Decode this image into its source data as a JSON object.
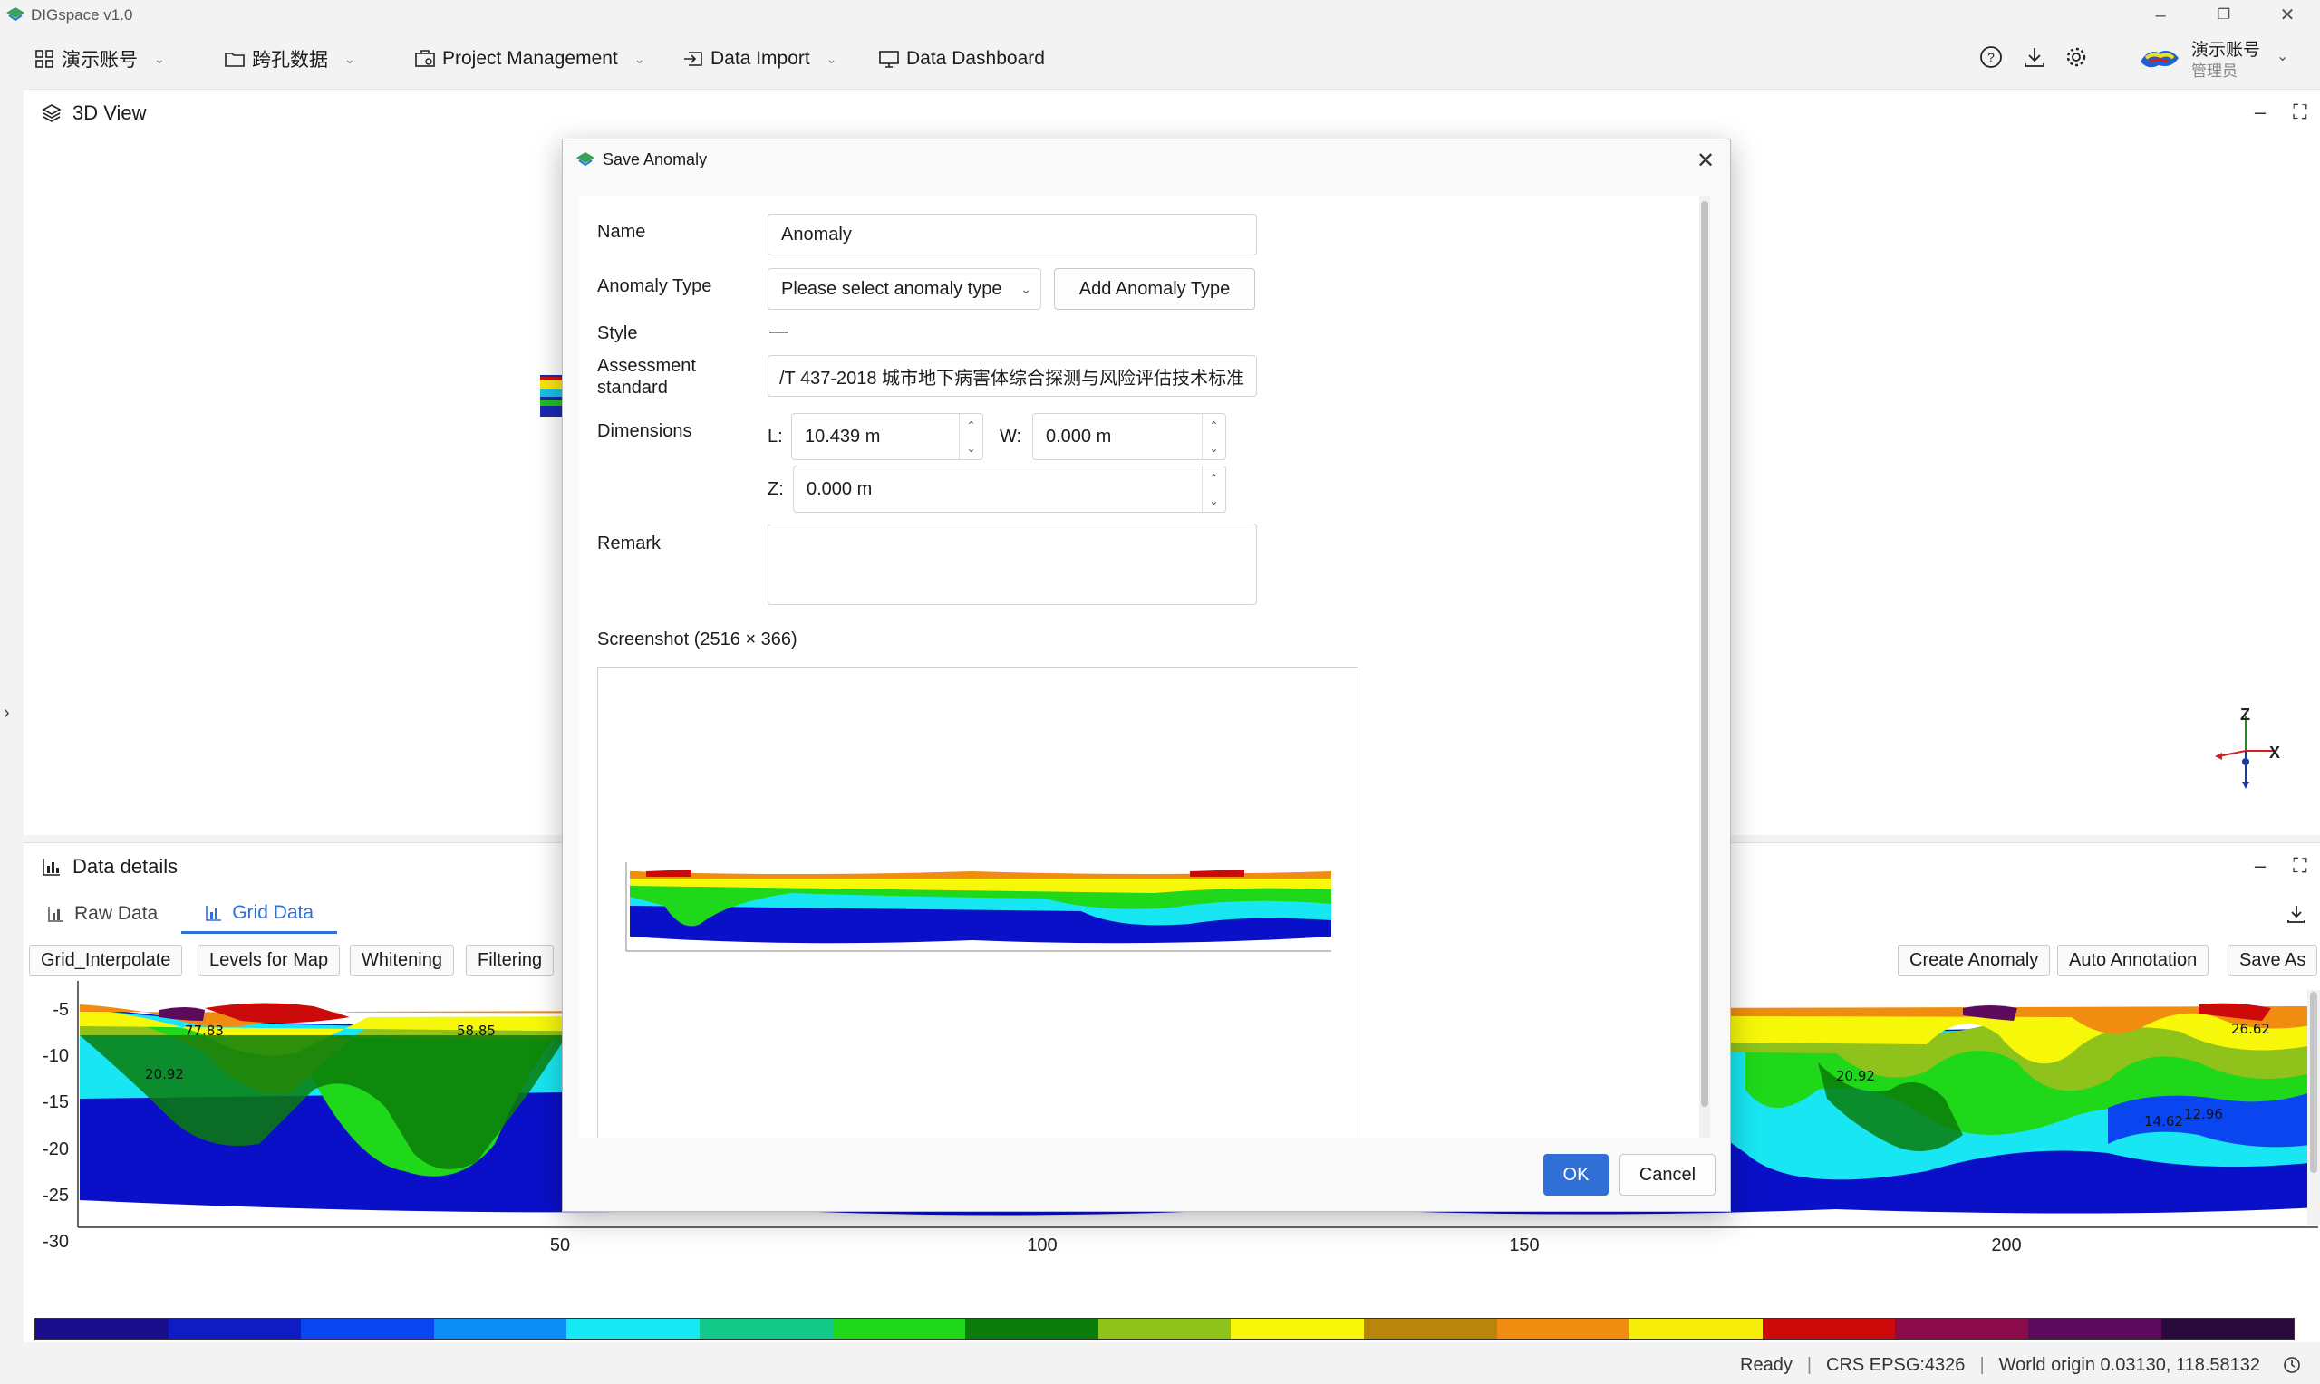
{
  "app": {
    "title": "DIGspace v1.0"
  },
  "menu": {
    "account": "演示账号",
    "borehole": "跨孔数据",
    "project": "Project Management",
    "import": "Data Import",
    "dashboard": "Data Dashboard"
  },
  "user": {
    "name": "演示账号",
    "role": "管理员"
  },
  "view3d": {
    "title": "3D View"
  },
  "details": {
    "title": "Data details",
    "tabs": [
      "Raw Data",
      "Grid Data"
    ],
    "active_tab": "Grid Data",
    "left_buttons": [
      "Grid_Interpolate",
      "Levels for Map",
      "Whitening",
      "Filtering"
    ],
    "right_buttons": [
      "Create Anomaly",
      "Auto Annotation",
      "Save As"
    ],
    "y_ticks": [
      "-5",
      "-10",
      "-15",
      "-20",
      "-25",
      "-30"
    ],
    "x_ticks": [
      "50",
      "100",
      "150",
      "200"
    ],
    "contour_labels": [
      "77.83",
      "58.85",
      "20.92",
      "14.62",
      "12.96",
      "26.62",
      "20.92"
    ]
  },
  "colorbar": [
    "#1a0d8c",
    "#0f1cc4",
    "#0a46f0",
    "#0c8cf5",
    "#17e8f6",
    "#13c98a",
    "#1fd81a",
    "#0a7d0a",
    "#8fc21a",
    "#f7f70a",
    "#b8860b",
    "#f08c10",
    "#f7ee0a",
    "#cc0a0a",
    "#8a0a4a",
    "#5c0a5c",
    "#2a0a3a"
  ],
  "status": {
    "ready": "Ready",
    "crs": "CRS EPSG:4326",
    "origin": "World origin  0.03130, 118.58132"
  },
  "axis": {
    "x": "X",
    "z": "Z"
  },
  "dialog": {
    "title": "Save Anomaly",
    "name_label": "Name",
    "name_value": "Anomaly",
    "type_label": "Anomaly Type",
    "type_placeholder": "Please select anomaly type",
    "add_type_button": "Add Anomaly Type",
    "style_label": "Style",
    "style_value": "—",
    "standard_label_1": "Assessment",
    "standard_label_2": "standard",
    "standard_value": "/T 437-2018 城市地下病害体综合探测与风险评估技术标准",
    "dim_label": "Dimensions",
    "l_label": "L:",
    "l_value": "10.439 m",
    "w_label": "W:",
    "w_value": "0.000 m",
    "z_label": "Z:",
    "z_value": "0.000 m",
    "remark_label": "Remark",
    "screenshot_label": "Screenshot (2516 × 366)",
    "ok": "OK",
    "cancel": "Cancel"
  }
}
